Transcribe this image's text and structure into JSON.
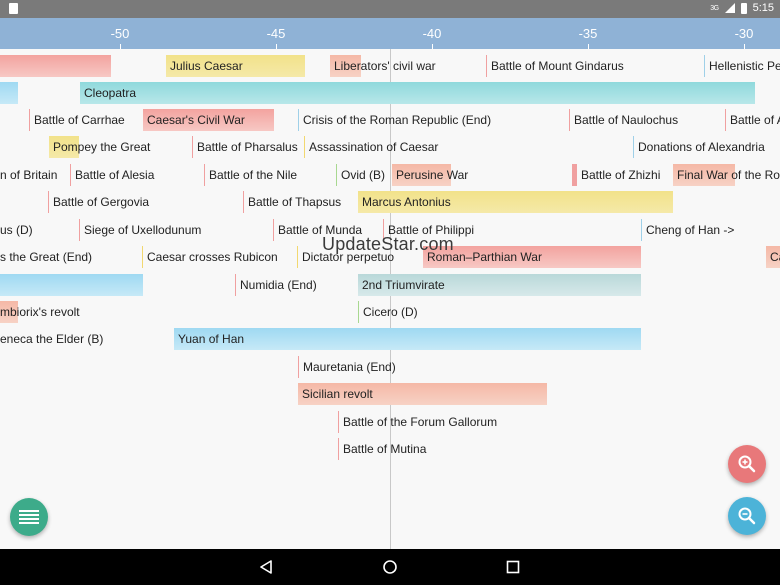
{
  "status_bar": {
    "signal": "3G",
    "time": "5:15"
  },
  "axis": {
    "ticks": [
      "-50",
      "-45",
      "-40",
      "-35",
      "-30"
    ]
  },
  "events": [
    {
      "label": "",
      "kind": "span",
      "color": "pink"
    },
    {
      "label": "Julius Caesar",
      "kind": "span",
      "color": "yellow"
    },
    {
      "label": "Liberators' civil war",
      "kind": "span-short",
      "color": "peach"
    },
    {
      "label": "Battle of Mount Gindarus",
      "kind": "point",
      "color": "#f0a0a0"
    },
    {
      "label": "Hellenistic Pe",
      "kind": "point",
      "color": "#9fd0e8"
    },
    {
      "label": "",
      "kind": "span",
      "color": "blue"
    },
    {
      "label": "Cleopatra",
      "kind": "span",
      "color": "cyan"
    },
    {
      "label": "Battle of Carrhae",
      "kind": "point",
      "color": "#f0a0a0"
    },
    {
      "label": "Caesar's Civil War",
      "kind": "span",
      "color": "pink"
    },
    {
      "label": "Crisis of the Roman Republic (End)",
      "kind": "point",
      "color": "#9fd0e8"
    },
    {
      "label": "Battle of Naulochus",
      "kind": "point",
      "color": "#f0a0a0"
    },
    {
      "label": "Battle of A",
      "kind": "point",
      "color": "#f0a0a0"
    },
    {
      "label": "Pompey the Great",
      "kind": "span-short",
      "color": "yellow"
    },
    {
      "label": "Battle of Pharsalus",
      "kind": "point",
      "color": "#f0a0a0"
    },
    {
      "label": "Assassination of Caesar",
      "kind": "point",
      "color": "#f2d870"
    },
    {
      "label": "Donations of Alexandria",
      "kind": "point",
      "color": "#9fd0e8"
    },
    {
      "label": "n of Britain",
      "kind": "point",
      "color": "#f0a0a0"
    },
    {
      "label": "Battle of Alesia",
      "kind": "point",
      "color": "#f0a0a0"
    },
    {
      "label": "Battle of the Nile",
      "kind": "point",
      "color": "#f0a0a0"
    },
    {
      "label": "Ovid (B)",
      "kind": "point",
      "color": "#a8d890"
    },
    {
      "label": "Perusine War",
      "kind": "span-short",
      "color": "peach"
    },
    {
      "label": "Battle of Zhizhi",
      "kind": "point",
      "color": "#f0a0a0"
    },
    {
      "label": "Final War of the Ro",
      "kind": "span-short",
      "color": "peach"
    },
    {
      "label": "Battle of Gergovia",
      "kind": "point",
      "color": "#f0a0a0"
    },
    {
      "label": "Battle of Thapsus",
      "kind": "point",
      "color": "#f0a0a0"
    },
    {
      "label": "Marcus Antonius",
      "kind": "span",
      "color": "yellow"
    },
    {
      "label": "us (D)",
      "kind": "point",
      "color": "#f0a0a0"
    },
    {
      "label": "Siege of Uxellodunum",
      "kind": "point",
      "color": "#f0a0a0"
    },
    {
      "label": "Battle of Munda",
      "kind": "point",
      "color": "#f0a0a0"
    },
    {
      "label": "Battle of Philippi",
      "kind": "point",
      "color": "#f0a0a0"
    },
    {
      "label": "Cheng of Han ->",
      "kind": "point",
      "color": "#9fd0e8"
    },
    {
      "label": "s the Great (End)",
      "kind": "point",
      "color": "#f2d870"
    },
    {
      "label": "Caesar crosses Rubicon",
      "kind": "point",
      "color": "#f2d870"
    },
    {
      "label": "Dictator perpetuo",
      "kind": "point",
      "color": "#f2d870"
    },
    {
      "label": "Roman–Parthian War",
      "kind": "span",
      "color": "pink"
    },
    {
      "label": "Ca",
      "kind": "span-short",
      "color": "peach"
    },
    {
      "label": "",
      "kind": "span",
      "color": "blue"
    },
    {
      "label": "Numidia (End)",
      "kind": "point",
      "color": "#f0a0a0"
    },
    {
      "label": "2nd Triumvirate",
      "kind": "span",
      "color": "greyg"
    },
    {
      "label": "mbiorix's revolt",
      "kind": "span-short",
      "color": "peach"
    },
    {
      "label": "Cicero (D)",
      "kind": "point",
      "color": "#a8d890"
    },
    {
      "label": "eneca the Elder (B)",
      "kind": "point",
      "color": "#a8d890"
    },
    {
      "label": "Yuan of Han",
      "kind": "span",
      "color": "blue"
    },
    {
      "label": "Mauretania (End)",
      "kind": "point",
      "color": "#f0a0a0"
    },
    {
      "label": "Sicilian revolt",
      "kind": "span",
      "color": "peach"
    },
    {
      "label": "Battle of the Forum Gallorum",
      "kind": "point",
      "color": "#f0a0a0"
    },
    {
      "label": "Battle of Mutina",
      "kind": "point",
      "color": "#f0a0a0"
    }
  ],
  "watermark": "UpdateStar.com",
  "fabs": {
    "menu": "menu-icon",
    "zoom_in": "zoom-in-icon",
    "zoom_out": "zoom-out-icon"
  }
}
